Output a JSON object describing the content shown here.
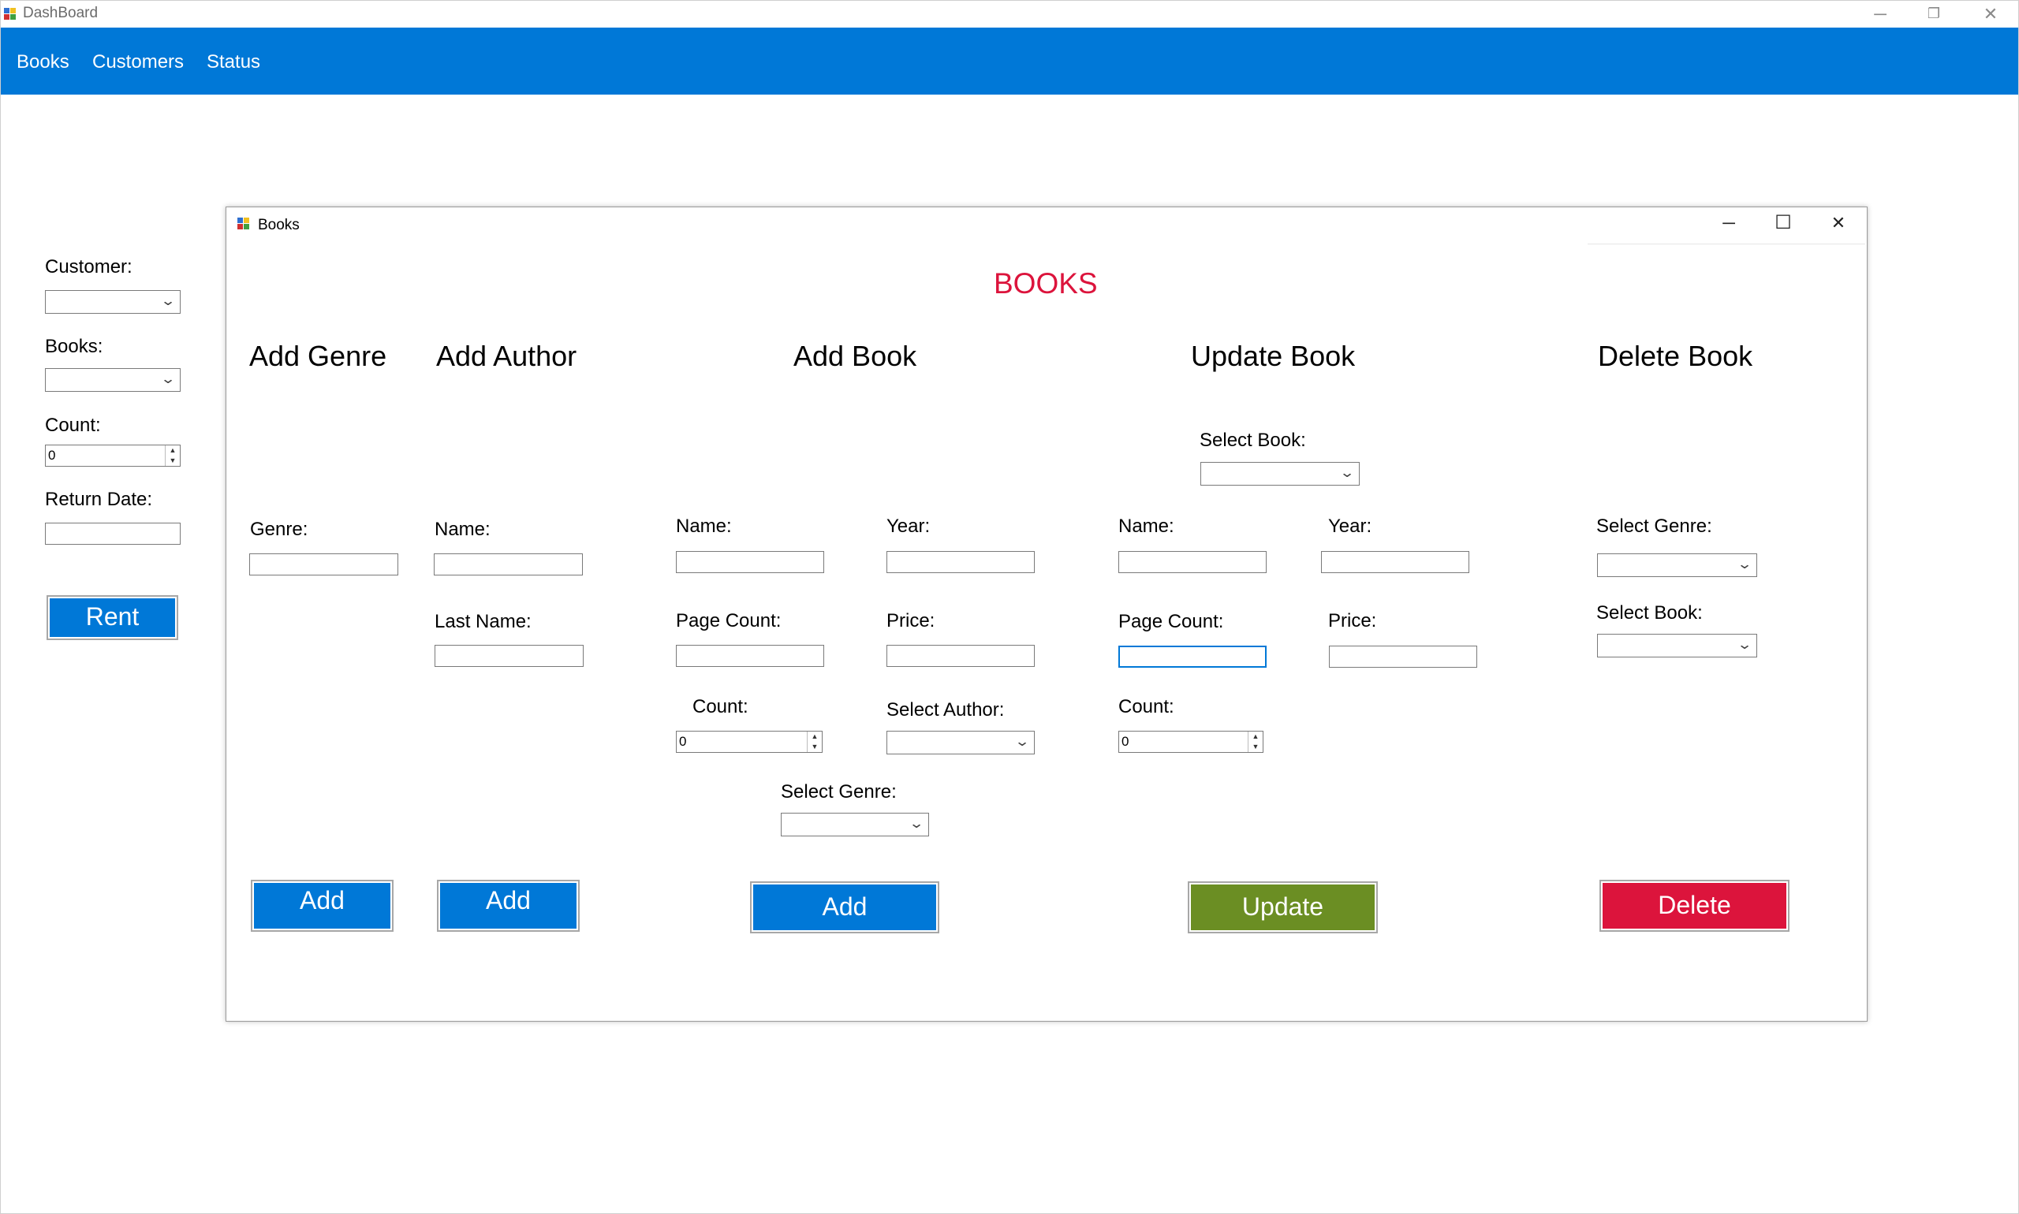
{
  "main_window": {
    "title": "DashBoard",
    "controls": {
      "minimize": "─",
      "restore": "❐",
      "close": "✕"
    }
  },
  "menu": {
    "items": [
      "Books",
      "Customers",
      "Status"
    ]
  },
  "rent_panel": {
    "customer_label": "Customer:",
    "books_label": "Books:",
    "count_label": "Count:",
    "count_value": "0",
    "return_date_label": "Return Date:",
    "rent_button": "Rent"
  },
  "books_window": {
    "title": "Books",
    "heading": "BOOKS",
    "controls": {
      "minimize": "─",
      "maximize": "☐",
      "close": "✕"
    },
    "add_genre": {
      "heading": "Add Genre",
      "genre_label": "Genre:",
      "button": "Add"
    },
    "add_author": {
      "heading": "Add Author",
      "name_label": "Name:",
      "last_name_label": "Last Name:",
      "button": "Add"
    },
    "add_book": {
      "heading": "Add Book",
      "name_label": "Name:",
      "year_label": "Year:",
      "page_count_label": "Page Count:",
      "price_label": "Price:",
      "count_label": "Count:",
      "count_value": "0",
      "select_author_label": "Select Author:",
      "select_genre_label": "Select Genre:",
      "button": "Add"
    },
    "update_book": {
      "heading": "Update Book",
      "select_book_label": "Select Book:",
      "name_label": "Name:",
      "year_label": "Year:",
      "page_count_label": "Page Count:",
      "price_label": "Price:",
      "count_label": "Count:",
      "count_value": "0",
      "button": "Update"
    },
    "delete_book": {
      "heading": "Delete Book",
      "select_genre_label": "Select Genre:",
      "select_book_label": "Select Book:",
      "button": "Delete"
    }
  },
  "colors": {
    "accent_blue": "#0078d7",
    "update_green": "#6b8e23",
    "delete_red": "#dc143c",
    "heading_red": "#dc143c"
  }
}
